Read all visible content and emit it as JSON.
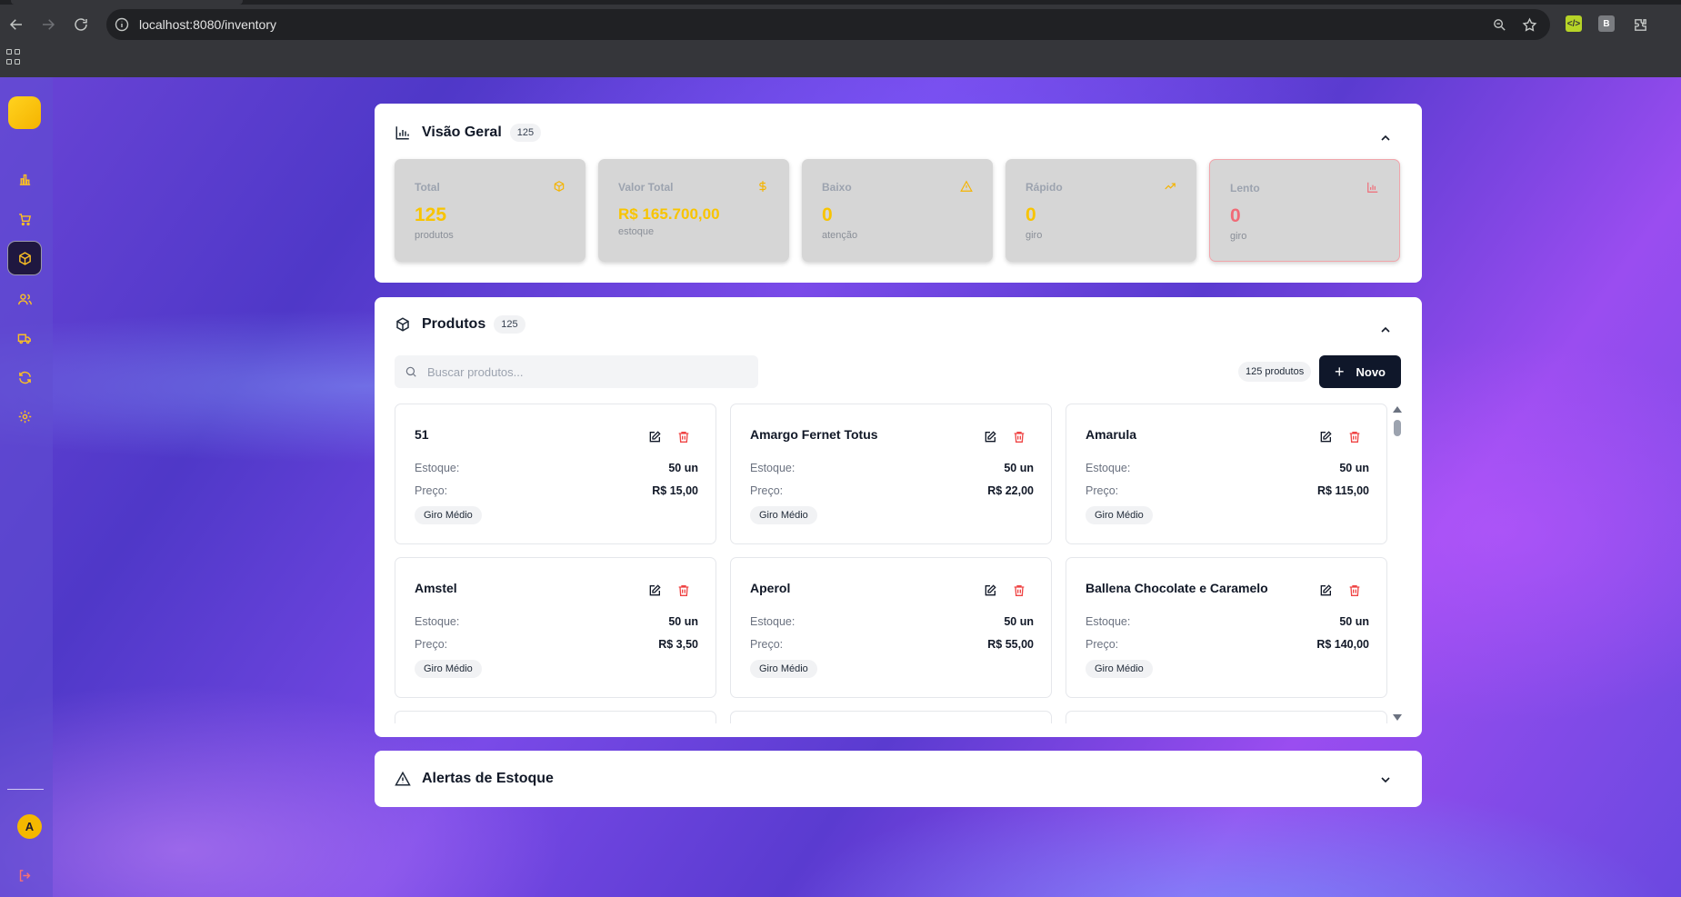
{
  "browser": {
    "url": "localhost:8080/inventory"
  },
  "overview": {
    "title": "Visão Geral",
    "count": "125",
    "stats": [
      {
        "label": "Total",
        "value": "125",
        "sub": "produtos",
        "icon": "package-icon"
      },
      {
        "label": "Valor Total",
        "value": "R$ 165.700,00",
        "sub": "estoque",
        "icon": "dollar-icon"
      },
      {
        "label": "Baixo",
        "value": "0",
        "sub": "atenção",
        "icon": "warning-icon"
      },
      {
        "label": "Rápido",
        "value": "0",
        "sub": "giro",
        "icon": "trending-up-icon"
      },
      {
        "label": "Lento",
        "value": "0",
        "sub": "giro",
        "icon": "bar-chart-icon"
      }
    ]
  },
  "products": {
    "title": "Produtos",
    "count": "125",
    "search_placeholder": "Buscar produtos...",
    "total_label": "125 produtos",
    "new_button": "Novo",
    "stock_label": "Estoque:",
    "price_label": "Preço:",
    "items": [
      {
        "name": "51",
        "stock": "50 un",
        "price": "R$ 15,00",
        "tag": "Giro Médio"
      },
      {
        "name": "Amargo Fernet Totus",
        "stock": "50 un",
        "price": "R$ 22,00",
        "tag": "Giro Médio"
      },
      {
        "name": "Amarula",
        "stock": "50 un",
        "price": "R$ 115,00",
        "tag": "Giro Médio"
      },
      {
        "name": "Amstel",
        "stock": "50 un",
        "price": "R$ 3,50",
        "tag": "Giro Médio"
      },
      {
        "name": "Aperol",
        "stock": "50 un",
        "price": "R$ 55,00",
        "tag": "Giro Médio"
      },
      {
        "name": "Ballena Chocolate e Caramelo",
        "stock": "50 un",
        "price": "R$ 140,00",
        "tag": "Giro Médio"
      }
    ]
  },
  "alerts": {
    "title": "Alertas de Estoque"
  },
  "user": {
    "initial": "A"
  },
  "colors": {
    "accent": "#f5b800",
    "danger": "#ef4444",
    "primary_button": "#0f172a"
  }
}
